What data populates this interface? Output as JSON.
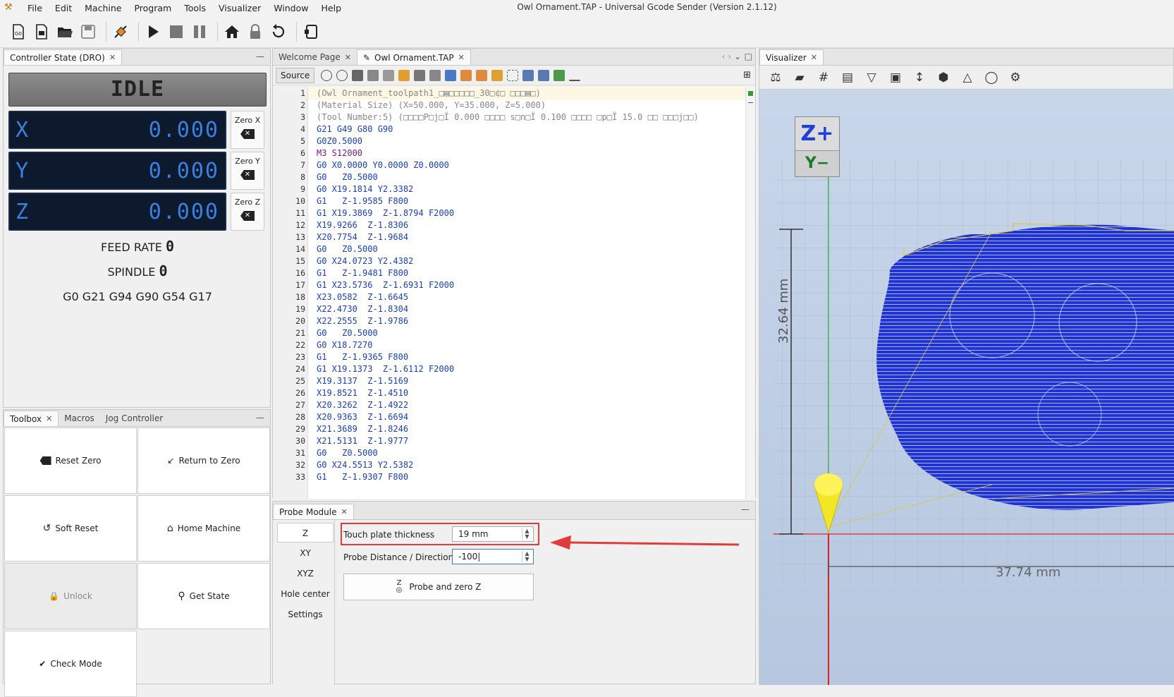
{
  "window": {
    "title": "Owl Ornament.TAP - Universal Gcode Sender (Version 2.1.12)"
  },
  "menu": [
    "File",
    "Edit",
    "Machine",
    "Program",
    "Tools",
    "Visualizer",
    "Window",
    "Help"
  ],
  "toolbar": {
    "icons": [
      "new-gcode-icon",
      "new-file-icon",
      "open-folder-icon",
      "save-icon",
      "connect-icon",
      "play-icon",
      "stop-icon",
      "pause-icon",
      "home-icon",
      "lock-icon",
      "reset-icon",
      "settings-icon"
    ]
  },
  "dro": {
    "tab_label": "Controller State (DRO)",
    "state": "IDLE",
    "axes": [
      {
        "letter": "X",
        "value": "0.000",
        "zero_label": "Zero X"
      },
      {
        "letter": "Y",
        "value": "0.000",
        "zero_label": "Zero Y"
      },
      {
        "letter": "Z",
        "value": "0.000",
        "zero_label": "Zero Z"
      }
    ],
    "feed_rate_label": "FEED RATE",
    "feed_rate_value": "0",
    "spindle_label": "SPINDLE",
    "spindle_value": "0",
    "gcode_state": "G0 G21 G94 G90 G54 G17"
  },
  "toolbox": {
    "tabs": [
      "Toolbox",
      "Macros",
      "Jog Controller"
    ],
    "buttons": [
      "Reset Zero",
      "Return to Zero",
      "Soft Reset",
      "Home Machine",
      "Unlock",
      "Get State",
      "Check Mode"
    ]
  },
  "editor": {
    "tabs": [
      "Welcome Page",
      "Owl Ornament.TAP"
    ],
    "source_button": "Source",
    "lines": [
      {
        "n": "1",
        "t": "(Owl Ornament_toolpath1_□▤□□□□□_30□¢□ □□□▤□)",
        "k": "c-cmt"
      },
      {
        "n": "2",
        "t": "(Material Size) (X=50.000, Y=35.000, Z=5.000)",
        "k": "c-cmt"
      },
      {
        "n": "3",
        "t": "(Tool Number:5) (□□□□P□j□Ï 0.000 □□□□ s□n□Ï 0.100 □□□□ □p□Ï 15.0 □□ □□□j□□)",
        "k": "c-cmt"
      },
      {
        "n": "4",
        "t": "G21 G49 G80 G90",
        "k": "c-g"
      },
      {
        "n": "5",
        "t": "G0Z0.5000",
        "k": "c-g"
      },
      {
        "n": "6",
        "t": "M3 S12000",
        "k": "c-m"
      },
      {
        "n": "7",
        "t": "G0 X0.0000 Y0.0000 Z0.0000",
        "k": "c-g"
      },
      {
        "n": "8",
        "t": "G0   Z0.5000",
        "k": "c-g"
      },
      {
        "n": "9",
        "t": "G0 X19.1814 Y2.3382",
        "k": "c-g"
      },
      {
        "n": "10",
        "t": "G1   Z-1.9585 F800",
        "k": "c-g"
      },
      {
        "n": "11",
        "t": "G1 X19.3869  Z-1.8794 F2000",
        "k": "c-g"
      },
      {
        "n": "12",
        "t": "X19.9266  Z-1.8306",
        "k": "c-g"
      },
      {
        "n": "13",
        "t": "X20.7754  Z-1.9684",
        "k": "c-g"
      },
      {
        "n": "14",
        "t": "G0   Z0.5000",
        "k": "c-g"
      },
      {
        "n": "15",
        "t": "G0 X24.0723 Y2.4382",
        "k": "c-g"
      },
      {
        "n": "16",
        "t": "G1   Z-1.9481 F800",
        "k": "c-g"
      },
      {
        "n": "17",
        "t": "G1 X23.5736  Z-1.6931 F2000",
        "k": "c-g"
      },
      {
        "n": "18",
        "t": "X23.0582  Z-1.6645",
        "k": "c-g"
      },
      {
        "n": "19",
        "t": "X22.4730  Z-1.8304",
        "k": "c-g"
      },
      {
        "n": "20",
        "t": "X22.2555  Z-1.9786",
        "k": "c-g"
      },
      {
        "n": "21",
        "t": "G0   Z0.5000",
        "k": "c-g"
      },
      {
        "n": "22",
        "t": "G0 X18.7270",
        "k": "c-g"
      },
      {
        "n": "23",
        "t": "G1   Z-1.9365 F800",
        "k": "c-g"
      },
      {
        "n": "24",
        "t": "G1 X19.1373  Z-1.6112 F2000",
        "k": "c-g"
      },
      {
        "n": "25",
        "t": "X19.3137  Z-1.5169",
        "k": "c-g"
      },
      {
        "n": "26",
        "t": "X19.8521  Z-1.4510",
        "k": "c-g"
      },
      {
        "n": "27",
        "t": "X20.3262  Z-1.4922",
        "k": "c-g"
      },
      {
        "n": "28",
        "t": "X20.9363  Z-1.6694",
        "k": "c-g"
      },
      {
        "n": "29",
        "t": "X21.3689  Z-1.8246",
        "k": "c-g"
      },
      {
        "n": "30",
        "t": "X21.5131  Z-1.9777",
        "k": "c-g"
      },
      {
        "n": "31",
        "t": "G0   Z0.5000",
        "k": "c-g"
      },
      {
        "n": "32",
        "t": "G0 X24.5513 Y2.5382",
        "k": "c-g"
      },
      {
        "n": "33",
        "t": "G1   Z-1.9307 F800",
        "k": "c-g"
      }
    ]
  },
  "probe": {
    "tab_label": "Probe Module",
    "modes": [
      "Z",
      "XY",
      "XYZ",
      "Hole center",
      "Settings"
    ],
    "active_mode": "Z",
    "touch_plate_label": "Touch plate thickness",
    "touch_plate_value": "19 mm",
    "distance_label": "Probe Distance / Direction:",
    "distance_value": "-100",
    "probe_button": "Probe and zero Z",
    "highlight_color": "#e03c3c"
  },
  "visualizer": {
    "tab_label": "Visualizer",
    "view_cube_top": "Z+",
    "view_cube_front": "Y−",
    "dim_height": "32.64 mm",
    "dim_width": "37.74 mm",
    "model_color": "#1f33d6",
    "bbox_color": "#d8c74a"
  }
}
